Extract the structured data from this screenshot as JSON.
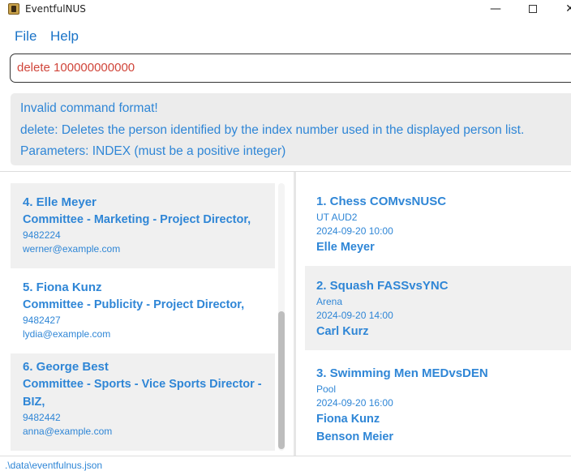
{
  "window": {
    "title": "EventfulNUS",
    "minimize": "—",
    "close": "✕"
  },
  "menu": {
    "file": "File",
    "help": "Help"
  },
  "command": {
    "value": "delete 100000000000"
  },
  "result": {
    "lines": [
      "Invalid command format!",
      "delete: Deletes the person identified by the index number used in the displayed person list.",
      "Parameters: INDEX (must be a positive integer)"
    ]
  },
  "persons": [
    {
      "name": "4. Elle Meyer",
      "roles": [
        "Committee - Marketing - Project Director,"
      ],
      "phone": "9482224",
      "email": "werner@example.com"
    },
    {
      "name": "5. Fiona Kunz",
      "roles": [
        "Committee - Publicity - Project Director,"
      ],
      "phone": "9482427",
      "email": "lydia@example.com"
    },
    {
      "name": "6. George Best",
      "roles": [
        "Committee - Sports - Vice Sports Director -",
        "BIZ,"
      ],
      "phone": "9482442",
      "email": "anna@example.com"
    }
  ],
  "events": [
    {
      "name": "1. Chess COMvsNUSC",
      "venue": "UT AUD2",
      "datetime": "2024-09-20 10:00",
      "participants": [
        "Elle Meyer"
      ]
    },
    {
      "name": "2. Squash FASSvsYNC",
      "venue": "Arena",
      "datetime": "2024-09-20 14:00",
      "participants": [
        "Carl Kurz"
      ]
    },
    {
      "name": "3. Swimming Men MEDvsDEN",
      "venue": "Pool",
      "datetime": "2024-09-20 16:00",
      "participants": [
        "Fiona Kunz",
        "Benson Meier"
      ]
    }
  ],
  "status": {
    "path": ".\\data\\eventfulnus.json"
  }
}
